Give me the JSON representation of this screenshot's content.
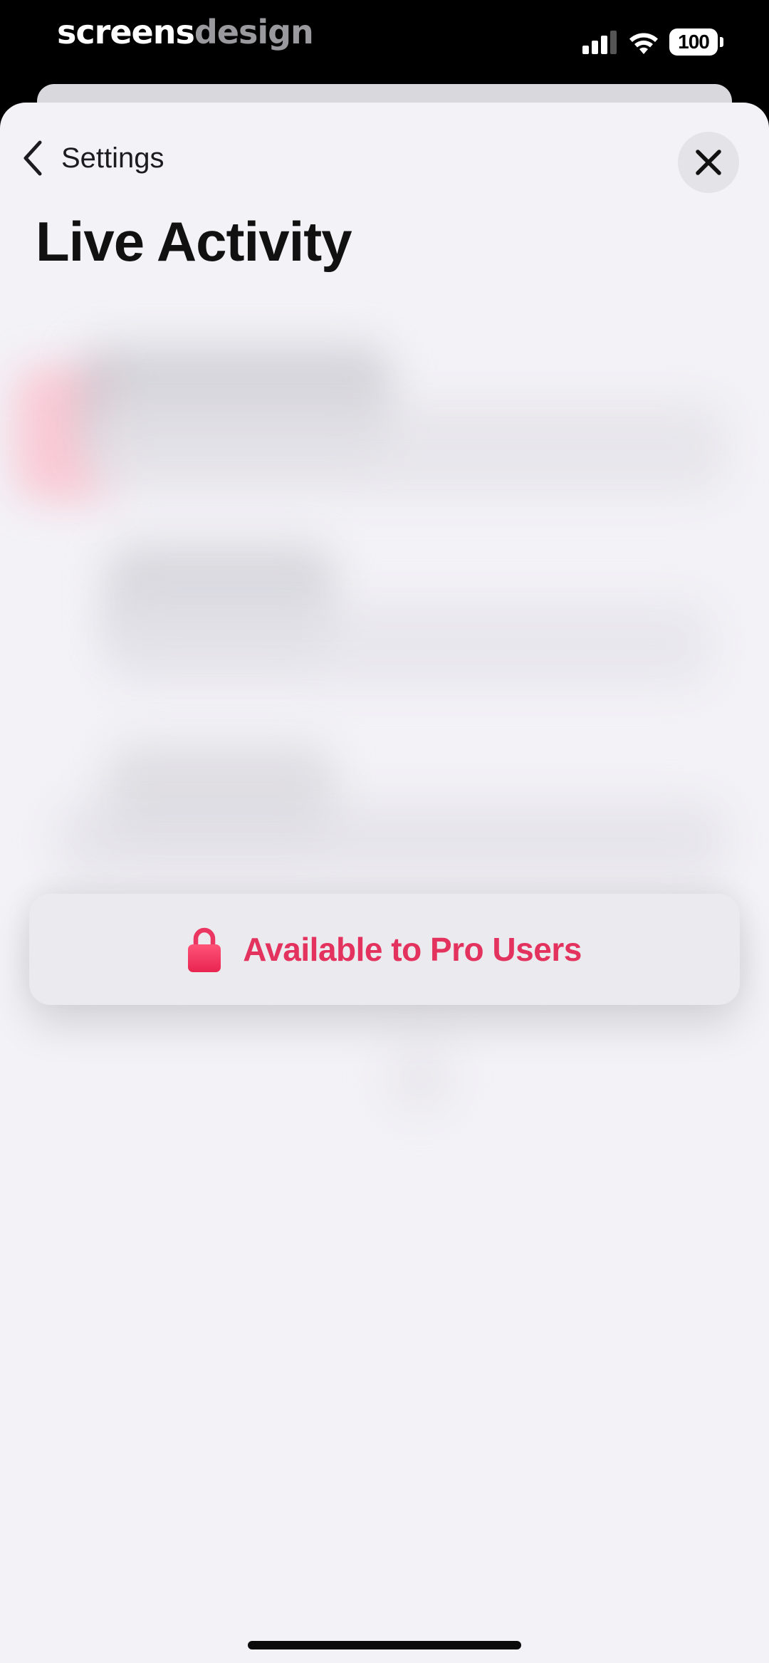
{
  "status_bar": {
    "brand_primary": "screens",
    "brand_secondary": "design",
    "battery_level": "100",
    "signal_bars_active": 3,
    "signal_bars_total": 4
  },
  "nav": {
    "back_label": "Settings",
    "back_icon": "chevron-left-icon",
    "close_icon": "close-icon"
  },
  "page": {
    "title": "Live Activity"
  },
  "pro_banner": {
    "label": "Available to Pro Users",
    "icon": "lock-icon"
  },
  "colors": {
    "accent": "#e4325e",
    "sheet_background": "#f3f2f7",
    "banner_background": "#ebeaef"
  }
}
